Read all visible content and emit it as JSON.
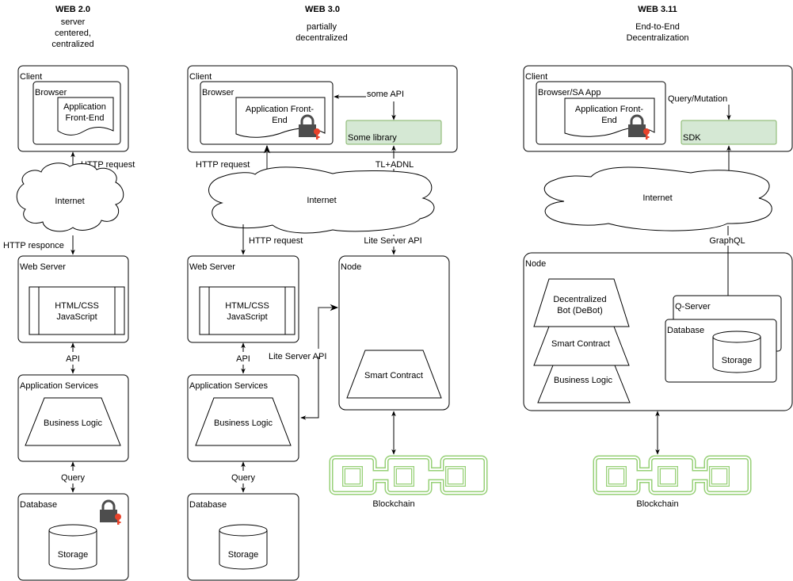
{
  "columns": {
    "web20": {
      "title": "WEB 2.0",
      "subtitle": [
        "server",
        "centered,",
        "centralized"
      ],
      "client": "Client",
      "browser": "Browser",
      "frontend": [
        "Application",
        "Front-End"
      ],
      "http_request": "HTTP request",
      "internet": "Internet",
      "http_response": "HTTP responce",
      "web_server": "Web Server",
      "web_code": [
        "HTML/CSS",
        "JavaScript"
      ],
      "api": "API",
      "app_services": "Application Services",
      "business_logic": "Business Logic",
      "query": "Query",
      "database": "Database",
      "storage": "Storage"
    },
    "web30": {
      "title": "WEB 3.0",
      "subtitle": [
        "partially",
        "decentralized"
      ],
      "client": "Client",
      "browser": "Browser",
      "frontend": [
        "Application Front-",
        "End"
      ],
      "some_api": "some API",
      "some_library": "Some library",
      "http_request_up": "HTTP request",
      "tl_adnl": "TL+ADNL",
      "internet": "Internet",
      "http_request_down": "HTTP request",
      "lite_server_api_top": "Lite Server API",
      "web_server": "Web Server",
      "web_code": [
        "HTML/CSS",
        "JavaScript"
      ],
      "node": "Node",
      "smart_contract": "Smart Contract",
      "api": "API",
      "lite_server_api_mid": "Lite Server API",
      "app_services": "Application Services",
      "business_logic": "Business Logic",
      "query": "Query",
      "database": "Database",
      "storage": "Storage",
      "blockchain": "Blockchain"
    },
    "web311": {
      "title": "WEB 3.11",
      "subtitle": [
        "End-to-End",
        "Decentralization"
      ],
      "client": "Client",
      "browser": "Browser/SA App",
      "frontend": [
        "Application Front-",
        "End"
      ],
      "query_mutation": "Query/Mutation",
      "sdk": "SDK",
      "internet": "Internet",
      "graphql": "GraphQL",
      "node": "Node",
      "debot": [
        "Decentralized",
        "Bot (DeBot)"
      ],
      "smart_contract": "Smart Contract",
      "business_logic": "Business Logic",
      "q_server": "Q-Server",
      "database": "Database",
      "storage": "Storage",
      "blockchain": "Blockchain"
    }
  },
  "colors": {
    "library_fill": "#d5e8d4",
    "library_stroke": "#82b366",
    "blockchain": "#97d077",
    "lock": "#4d4d4d",
    "key": "#e8422a"
  }
}
